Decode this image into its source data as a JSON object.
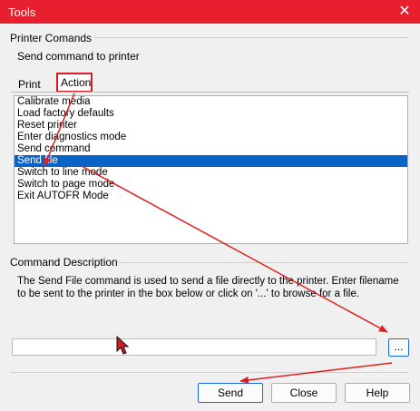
{
  "window": {
    "title": "Tools",
    "close_glyph": "✕"
  },
  "printer": {
    "section_label": "Printer Comands",
    "subtitle": "Send command to printer"
  },
  "tabs": [
    {
      "label": "Print"
    },
    {
      "label": "Action",
      "active": true
    }
  ],
  "actions": [
    "Calibrate media",
    "Load factory defaults",
    "Reset printer",
    "Enter diagnostics mode",
    "Send command",
    "Send file",
    "Switch to line mode",
    "Switch to page mode",
    "Exit AUTOFR Mode"
  ],
  "selected_action": "Send file",
  "description": {
    "section_label": "Command Description",
    "text": "The Send File command is used to send a file directly to the printer. Enter filename to be sent to the printer in the box below or click on '...' to browse for a file."
  },
  "file_field": {
    "value": "",
    "placeholder": ""
  },
  "browse_label": "...",
  "buttons": {
    "send": "Send",
    "close": "Close",
    "help": "Help"
  },
  "colors": {
    "title_bar": "#e81f2e",
    "selection": "#0a64c8",
    "annotation": "#e0201f"
  },
  "icons": {
    "close": "close-icon",
    "cursor": "mouse-pointer-icon"
  }
}
